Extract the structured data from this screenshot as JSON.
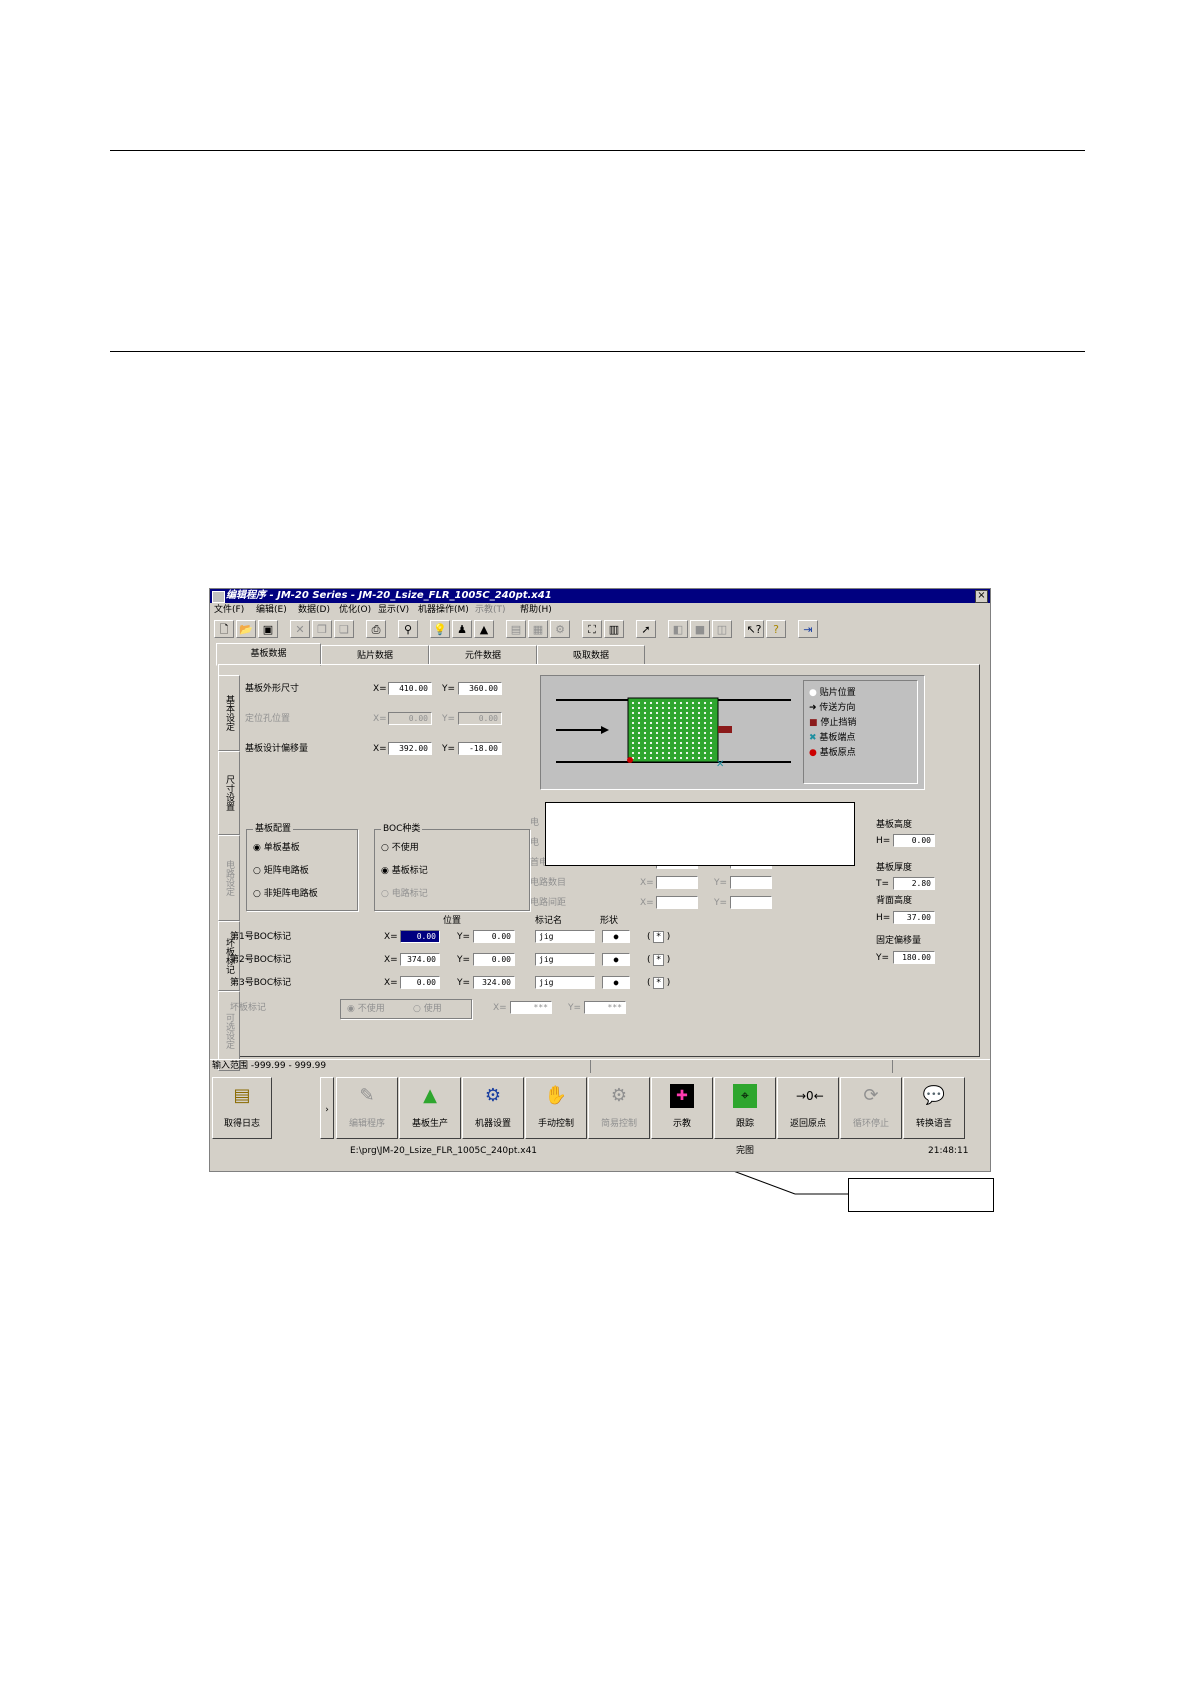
{
  "window": {
    "title": "编辑程序 - JM-20 Series - JM-20_Lsize_FLR_1005C_240pt.x41",
    "close_label": "×"
  },
  "menu": [
    "文件(F)",
    "编辑(E)",
    "数据(D)",
    "优化(O)",
    "显示(V)",
    "机器操作(M)",
    "示教(T)",
    "帮助(H)"
  ],
  "tabs": [
    "基板数据",
    "贴片数据",
    "元件数据",
    "吸取数据"
  ],
  "side_tabs": [
    "基本设定",
    "尺寸设置",
    "电路设定",
    "坏板标记",
    "可选设定"
  ],
  "board": {
    "outline_label": "基板外形尺寸",
    "outline_x": "410.00",
    "outline_y": "360.00",
    "hole_label": "定位孔位置",
    "hole_x": "0.00",
    "hole_y": "0.00",
    "offset_label": "基板设计偏移量",
    "offset_x": "392.00",
    "offset_y": "-18.00",
    "x_prefix": "X=",
    "y_prefix": "Y=",
    "h_prefix": "H="
  },
  "board_config": {
    "title": "基板配置",
    "options": [
      "单板基板",
      "矩阵电路板",
      "非矩阵电路板"
    ]
  },
  "boc_type": {
    "title": "BOC种类",
    "options": [
      "不使用",
      "基板标记",
      "电路标记"
    ]
  },
  "circuit": {
    "labels": [
      "电",
      "电",
      "首电路位置",
      "电路数目",
      "电路间距"
    ]
  },
  "boc_marks": {
    "position_header": "位置",
    "mark_name_header": "标记名",
    "shape_header": "形状",
    "rows": [
      {
        "label": "第1号BOC标记",
        "x": "0.00",
        "y": "0.00",
        "name": "jig",
        "shape": "●",
        "flag": "*"
      },
      {
        "label": "第2号BOC标记",
        "x": "374.00",
        "y": "0.00",
        "name": "jig",
        "shape": "●",
        "flag": "*"
      },
      {
        "label": "第3号BOC标记",
        "x": "0.00",
        "y": "324.00",
        "name": "jig",
        "shape": "●",
        "flag": "*"
      }
    ]
  },
  "bad_mark": {
    "label": "坏板标记",
    "opt_off": "不使用",
    "opt_on": "使用",
    "x": "***",
    "y": "***"
  },
  "right_fields": {
    "height_label": "基板高度",
    "height_val": "0.00",
    "thickness_label": "基板厚度",
    "thickness_val": "2.80",
    "back_label": "背面高度",
    "back_val": "37.00",
    "fixed_label": "固定偏移量",
    "fixed_val": "180.00",
    "t_prefix": "T="
  },
  "legend": [
    "贴片位置",
    "传送方向",
    "停止挡销",
    "基板端点",
    "基板原点"
  ],
  "status_bar": {
    "range": "输入范围 -999.99 - 999.99"
  },
  "bottom_buttons": [
    "取得日志",
    "编辑程序",
    "基板生产",
    "机器设置",
    "手动控制",
    "简易控制",
    "示教",
    "跟踪",
    "返回原点",
    "循环停止",
    "转换语言"
  ],
  "bottom_status": {
    "path": "E:\\prg\\JM-20_Lsize_FLR_1005C_240pt.x41",
    "state": "完图",
    "time": "21:48:11"
  },
  "colors": {
    "board_green": "#2ea62e",
    "title_blue": "#000080",
    "stop_pin": "#8b1a1a",
    "origin": "#cc0000",
    "endpoint": "#1e8fa0"
  }
}
